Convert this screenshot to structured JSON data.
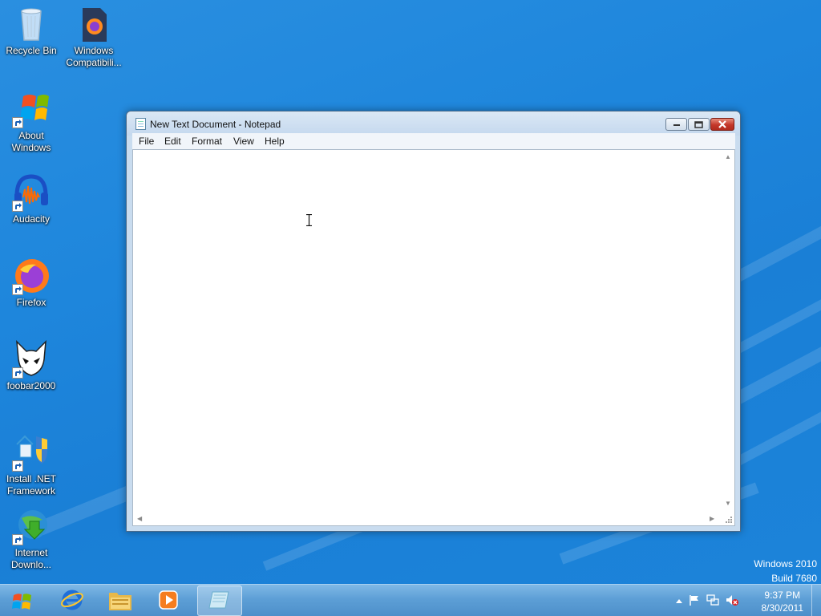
{
  "desktop": {
    "icons": [
      {
        "id": "recycle-bin",
        "label": "Recycle Bin",
        "icon": "recycle-bin-icon"
      },
      {
        "id": "windows-compat",
        "label": "Windows\nCompatibili...",
        "icon": "firefox-file-icon"
      },
      {
        "id": "about-windows",
        "label": "About\nWindows",
        "icon": "windows-flag-icon"
      },
      {
        "id": "audacity",
        "label": "Audacity",
        "icon": "audacity-icon"
      },
      {
        "id": "firefox",
        "label": "Firefox",
        "icon": "firefox-icon"
      },
      {
        "id": "foobar2000",
        "label": "foobar2000",
        "icon": "foobar2000-icon"
      },
      {
        "id": "install-net",
        "label": "Install .NET\nFramework",
        "icon": "net-framework-icon"
      },
      {
        "id": "internet-download",
        "label": "Internet\nDownlo...",
        "icon": "internet-download-manager-icon"
      }
    ],
    "watermark": {
      "line1": "Windows 2010",
      "line2": "Build 7680"
    }
  },
  "notepad": {
    "title": "New Text Document - Notepad",
    "menu": [
      "File",
      "Edit",
      "Format",
      "View",
      "Help"
    ],
    "content": ""
  },
  "taskbar": {
    "buttons": [
      "start-orb-icon",
      "internet-explorer-icon",
      "file-explorer-icon",
      "media-player-icon",
      "notepad-icon"
    ],
    "active_button": "notepad-icon",
    "tray_icons": [
      "show-hidden-icons-chevron",
      "action-center-flag-icon",
      "network-icon",
      "volume-muted-icon"
    ],
    "clock": {
      "time": "9:37 PM",
      "date": "8/30/2011"
    }
  },
  "colors": {
    "desktop": "#1e86dc",
    "taskbar": "#5d9fd6",
    "close_button": "#c4382a"
  }
}
